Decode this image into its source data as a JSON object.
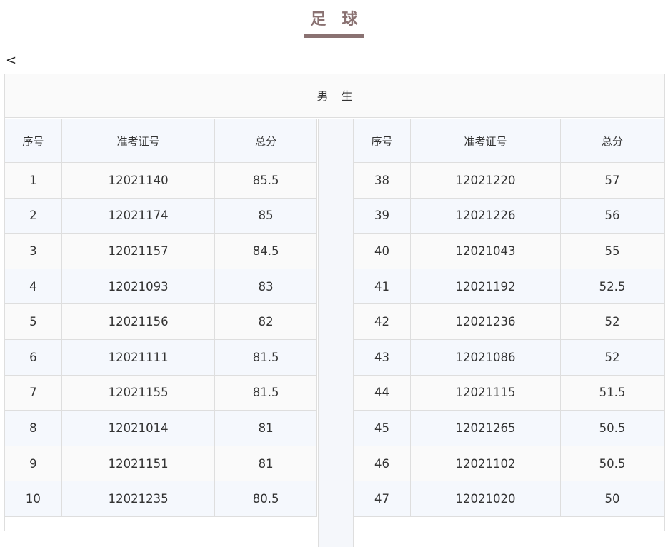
{
  "page": {
    "title": "足球",
    "back_label": "<"
  },
  "section": {
    "heading": "男生"
  },
  "table": {
    "headers": [
      "序号",
      "准考证号",
      "总分"
    ],
    "left_rows": [
      [
        "1",
        "12021140",
        "85.5"
      ],
      [
        "2",
        "12021174",
        "85"
      ],
      [
        "3",
        "12021157",
        "84.5"
      ],
      [
        "4",
        "12021093",
        "83"
      ],
      [
        "5",
        "12021156",
        "82"
      ],
      [
        "6",
        "12021111",
        "81.5"
      ],
      [
        "7",
        "12021155",
        "81.5"
      ],
      [
        "8",
        "12021014",
        "81"
      ],
      [
        "9",
        "12021151",
        "81"
      ],
      [
        "10",
        "12021235",
        "80.5"
      ]
    ],
    "right_rows": [
      [
        "38",
        "12021220",
        "57"
      ],
      [
        "39",
        "12021226",
        "56"
      ],
      [
        "40",
        "12021043",
        "55"
      ],
      [
        "41",
        "12021192",
        "52.5"
      ],
      [
        "42",
        "12021236",
        "52"
      ],
      [
        "43",
        "12021086",
        "52"
      ],
      [
        "44",
        "12021115",
        "51.5"
      ],
      [
        "45",
        "12021265",
        "50.5"
      ],
      [
        "46",
        "12021102",
        "50.5"
      ],
      [
        "47",
        "12021020",
        "50"
      ]
    ]
  },
  "colors": {
    "title": "#8a7272",
    "border": "#dedede",
    "row_alt": "#f5f8fd",
    "row_base": "#fafafa"
  }
}
